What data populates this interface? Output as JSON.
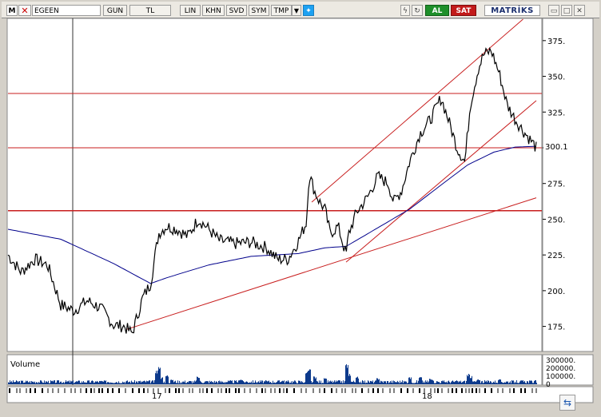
{
  "toolbar": {
    "logo": "M",
    "flag_icon": "flag-icon",
    "symbol": "EGEEN",
    "period": "GUN",
    "currency": "TL",
    "scale": "LIN",
    "khn": "KHN",
    "svd": "SVD",
    "sym": "SYM",
    "tmp": "TMP",
    "dropdown_icon": "chevron-down-icon",
    "twitter_icon": "bird-icon",
    "bolt_icon": "lightning-icon",
    "refresh_icon": "refresh-icon",
    "buy": "AL",
    "sell": "SAT",
    "brand": "MATRİKS",
    "window_icons": [
      "minimize-icon",
      "maximize-icon",
      "close-icon"
    ]
  },
  "chart_data": {
    "type": "line",
    "price_axis": {
      "ticks": [
        175,
        200,
        225,
        250,
        275,
        300,
        325,
        350,
        375
      ],
      "ylim": [
        158,
        390
      ]
    },
    "last_price_label": "300.1",
    "x_labels": [
      "17",
      "18"
    ],
    "volume_panel": {
      "title": "Volume",
      "ticks": [
        "300000.",
        "200000.",
        "100000.",
        "0"
      ],
      "ylim": [
        0,
        320000
      ]
    },
    "price_series": {
      "name": "",
      "knots": [
        [
          0,
          225
        ],
        [
          0.025,
          213
        ],
        [
          0.05,
          222
        ],
        [
          0.075,
          218
        ],
        [
          0.1,
          190
        ],
        [
          0.125,
          186
        ],
        [
          0.15,
          193
        ],
        [
          0.175,
          188
        ],
        [
          0.2,
          176
        ],
        [
          0.22,
          175
        ],
        [
          0.235,
          170
        ],
        [
          0.255,
          195
        ],
        [
          0.27,
          205
        ],
        [
          0.285,
          240
        ],
        [
          0.3,
          245
        ],
        [
          0.32,
          243
        ],
        [
          0.34,
          238
        ],
        [
          0.36,
          250
        ],
        [
          0.375,
          245
        ],
        [
          0.4,
          235
        ],
        [
          0.43,
          233
        ],
        [
          0.46,
          234
        ],
        [
          0.49,
          230
        ],
        [
          0.51,
          222
        ],
        [
          0.53,
          222
        ],
        [
          0.55,
          235
        ],
        [
          0.565,
          248
        ],
        [
          0.57,
          282
        ],
        [
          0.58,
          270
        ],
        [
          0.59,
          262
        ],
        [
          0.6,
          257
        ],
        [
          0.61,
          240
        ],
        [
          0.625,
          245
        ],
        [
          0.64,
          225
        ],
        [
          0.645,
          240
        ],
        [
          0.66,
          255
        ],
        [
          0.68,
          265
        ],
        [
          0.7,
          280
        ],
        [
          0.72,
          275
        ],
        [
          0.73,
          262
        ],
        [
          0.745,
          270
        ],
        [
          0.76,
          290
        ],
        [
          0.78,
          310
        ],
        [
          0.8,
          320
        ],
        [
          0.82,
          335
        ],
        [
          0.835,
          318
        ],
        [
          0.85,
          300
        ],
        [
          0.865,
          290
        ],
        [
          0.875,
          330
        ],
        [
          0.89,
          355
        ],
        [
          0.9,
          365
        ],
        [
          0.915,
          368
        ],
        [
          0.93,
          352
        ],
        [
          0.945,
          330
        ],
        [
          0.96,
          320
        ],
        [
          0.975,
          312
        ],
        [
          0.99,
          305
        ],
        [
          1,
          300
        ]
      ]
    },
    "moving_average": {
      "name": "",
      "knots": [
        [
          0,
          243
        ],
        [
          0.1,
          236
        ],
        [
          0.2,
          219
        ],
        [
          0.27,
          205
        ],
        [
          0.3,
          209
        ],
        [
          0.38,
          218
        ],
        [
          0.46,
          224
        ],
        [
          0.55,
          226
        ],
        [
          0.6,
          230
        ],
        [
          0.64,
          231
        ],
        [
          0.7,
          244
        ],
        [
          0.76,
          257
        ],
        [
          0.82,
          274
        ],
        [
          0.87,
          288
        ],
        [
          0.92,
          297
        ],
        [
          0.96,
          300.5
        ],
        [
          1,
          301
        ]
      ]
    },
    "horizontal_lines": [
      338,
      300,
      256
    ],
    "trend_lines": [
      {
        "from": [
          0.225,
          173
        ],
        "to": [
          1,
          265
        ]
      },
      {
        "from": [
          0.64,
          220
        ],
        "to": [
          1,
          333
        ]
      },
      {
        "from": [
          0.575,
          262
        ],
        "to": [
          1,
          398
        ]
      }
    ],
    "volume_bars": {
      "baseline": 30000,
      "spikes": [
        [
          0.28,
          160000
        ],
        [
          0.285,
          210000
        ],
        [
          0.29,
          80000
        ],
        [
          0.3,
          110000
        ],
        [
          0.31,
          60000
        ],
        [
          0.36,
          90000
        ],
        [
          0.44,
          60000
        ],
        [
          0.52,
          45000
        ],
        [
          0.565,
          140000
        ],
        [
          0.57,
          180000
        ],
        [
          0.58,
          90000
        ],
        [
          0.6,
          70000
        ],
        [
          0.64,
          240000
        ],
        [
          0.645,
          130000
        ],
        [
          0.66,
          90000
        ],
        [
          0.7,
          70000
        ],
        [
          0.76,
          80000
        ],
        [
          0.78,
          85000
        ],
        [
          0.8,
          70000
        ],
        [
          0.87,
          120000
        ],
        [
          0.875,
          95000
        ],
        [
          0.89,
          60000
        ],
        [
          0.93,
          55000
        ],
        [
          0.97,
          40000
        ]
      ]
    }
  }
}
